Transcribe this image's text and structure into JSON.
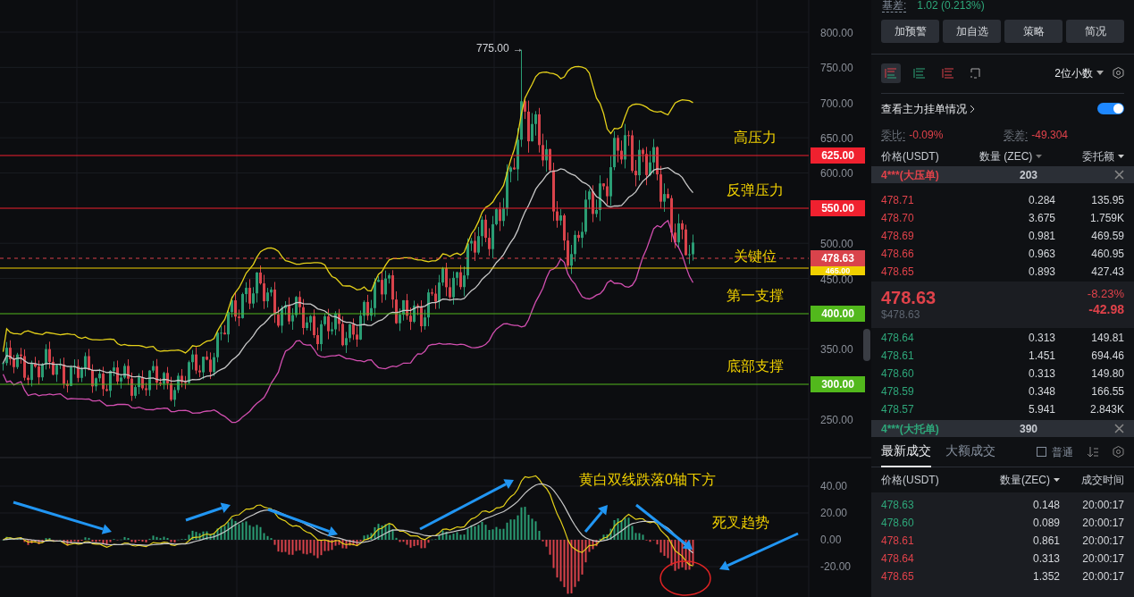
{
  "chart": {
    "price_axis": [
      "800.00",
      "750.00",
      "700.00",
      "650.00",
      "600.00",
      "500.00",
      "450.00",
      "350.00",
      "250.00"
    ],
    "peak_label": "775.00",
    "peak_arrow": "→",
    "levels": [
      {
        "label": "625.00",
        "note": "高压力",
        "color": "#f0212f",
        "kind": "line"
      },
      {
        "label": "550.00",
        "note": "反弹压力",
        "color": "#f0212f",
        "kind": "line"
      },
      {
        "label": "478.63",
        "note": "关键位",
        "color": "#d9434b",
        "kind": "current"
      },
      {
        "label": "465.00",
        "color": "#f0d000",
        "kind": "line"
      },
      {
        "label": "400.00",
        "note": "第一支撑",
        "color": "#52b81c",
        "kind": "line"
      },
      {
        "label": "300.00",
        "note": "底部支撑",
        "color": "#52b81c",
        "kind": "line"
      }
    ],
    "macd_axis": [
      "40.00",
      "20.00",
      "0.00",
      "-20.00"
    ],
    "macd_notes": [
      "黄白双线跌落0轴下方",
      "死叉趋势"
    ]
  },
  "panel": {
    "basis_label": "基差:",
    "basis_value": "1.02 (0.213%)",
    "buttons": [
      "加预警",
      "加自选",
      "策略",
      "简况"
    ],
    "layout_modes": [
      {
        "kind": "both",
        "selected": true
      },
      {
        "kind": "bids",
        "selected": false
      },
      {
        "kind": "asks",
        "selected": false
      },
      {
        "kind": "custom",
        "selected": false
      }
    ],
    "decimals": "2位小数",
    "main_orders": {
      "label": "查看主力挂单情况",
      "on": true
    },
    "ratio_label": "委比:",
    "ratio_value": "-0.09%",
    "diff_label": "委差:",
    "diff_value": "-49.304",
    "book_columns": [
      "价格(USDT)",
      "数量 (ZEC)",
      "委托额"
    ],
    "ask_banner": {
      "label": "4***(大压单)",
      "qty": "203"
    },
    "asks": [
      [
        "478.71",
        "0.284",
        "135.95"
      ],
      [
        "478.70",
        "3.675",
        "1.759K"
      ],
      [
        "478.69",
        "0.981",
        "469.59"
      ],
      [
        "478.66",
        "0.963",
        "460.95"
      ],
      [
        "478.65",
        "0.893",
        "427.43"
      ]
    ],
    "last_price": "478.63",
    "last_usd": "$478.63",
    "change_pct": "-8.23%",
    "change_abs": "-42.98",
    "bids": [
      [
        "478.64",
        "0.313",
        "149.81"
      ],
      [
        "478.61",
        "1.451",
        "694.46"
      ],
      [
        "478.60",
        "0.313",
        "149.80"
      ],
      [
        "478.59",
        "0.348",
        "166.55"
      ],
      [
        "478.57",
        "5.941",
        "2.843K"
      ]
    ],
    "bid_banner": {
      "label": "4***(大托单)",
      "qty": "390"
    },
    "trade_tabs": [
      {
        "label": "最新成交",
        "selected": true
      },
      {
        "label": "大额成交",
        "selected": false
      }
    ],
    "normal_filter": {
      "label": "普通",
      "checked": false
    },
    "trade_columns": [
      "价格(USDT)",
      "数量(ZEC)",
      "成交时间"
    ],
    "trades": [
      {
        "price": "478.63",
        "qty": "0.148",
        "time": "20:00:17",
        "color": "#2ea77a"
      },
      {
        "price": "478.60",
        "qty": "0.089",
        "time": "20:00:17",
        "color": "#2ea77a"
      },
      {
        "price": "478.61",
        "qty": "0.861",
        "time": "20:00:17",
        "color": "#e0424a"
      },
      {
        "price": "478.64",
        "qty": "0.313",
        "time": "20:00:17",
        "color": "#e0424a"
      },
      {
        "price": "478.65",
        "qty": "1.352",
        "time": "20:00:17",
        "color": "#e0424a"
      }
    ]
  }
}
